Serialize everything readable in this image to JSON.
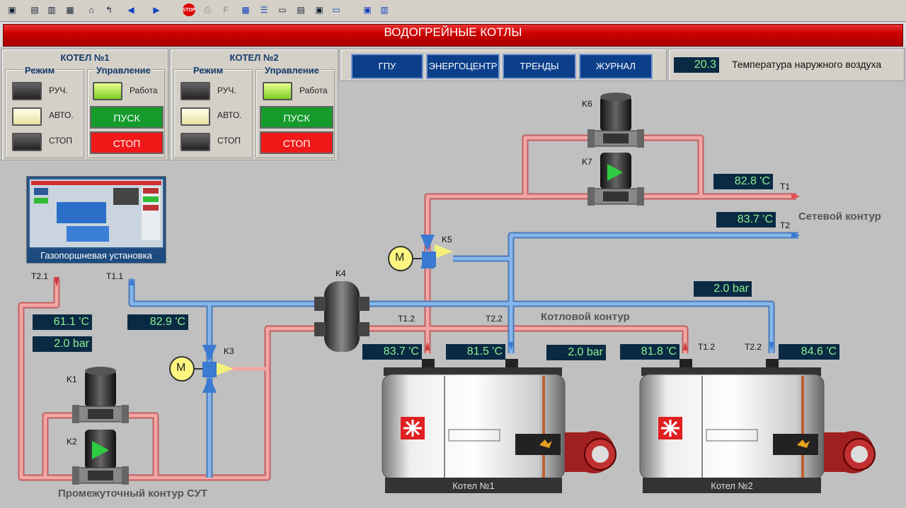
{
  "title": "ВОДОГРЕЙНЫЕ КОТЛЫ",
  "boiler1": {
    "title": "КОТЕЛ №1",
    "mode_label": "Режим",
    "control_label": "Управление",
    "modes": [
      "РУЧ.",
      "АВТО.",
      "СТОП"
    ],
    "work_label": "Работа",
    "start_label": "ПУСК",
    "stop_label": "СТОП"
  },
  "boiler2": {
    "title": "КОТЕЛ №2",
    "mode_label": "Режим",
    "control_label": "Управление",
    "modes": [
      "РУЧ.",
      "АВТО.",
      "СТОП"
    ],
    "work_label": "Работа",
    "start_label": "ПУСК",
    "stop_label": "СТОП"
  },
  "nav": [
    "ГПУ",
    "ЭНЕРГОЦЕНТР",
    "ТРЕНДЫ",
    "ЖУРНАЛ"
  ],
  "outdoor": {
    "value": "20.3",
    "label": "Температура наружного воздуха"
  },
  "gpu_label": "Газопоршневая установка",
  "circuits": {
    "network": "Сетевой контур",
    "boiler": "Котловой контур",
    "intermediate": "Промежуточный контур СУТ"
  },
  "readouts": {
    "t1": "82.8 'C",
    "t2": "83.7 'C",
    "bar_right": "2.0 bar",
    "t21": "61.1 'C",
    "bar_left": "2.0 bar",
    "t11": "82.9 'C",
    "b1_t12": "83.7 'C",
    "b1_t22": "81.5 'C",
    "bar_mid": "2.0 bar",
    "b2_t12": "81.8 'C",
    "b2_t22": "84.6 'C"
  },
  "tags": {
    "T1": "T1",
    "T2": "T2",
    "T21": "T2.1",
    "T11": "T1.1",
    "T12": "T1.2",
    "T22": "T2.2",
    "K1": "K1",
    "K2": "K2",
    "K3": "K3",
    "K4": "K4",
    "K5": "K5",
    "K6": "K6",
    "K7": "K7",
    "M": "M"
  },
  "boilers": [
    "Котел №1",
    "Котел №2"
  ],
  "colors": {
    "hot": "#f0a0a0",
    "cold": "#7ab0e8",
    "title_red": "#d00000",
    "nav_blue": "#0c3f8a",
    "readout_bg": "#0a2a44",
    "readout_text": "#8ef08e"
  },
  "toolbar_icons": [
    "print-icon",
    "window-icon",
    "layers-icon",
    "chart-icon",
    "home-icon",
    "back-icon",
    "left-arrow-icon",
    "right-arrow-icon",
    "stop-icon",
    "doc-icon",
    "f-icon",
    "grid-icon",
    "list-icon",
    "monitor-icon",
    "form-icon",
    "doc2-icon",
    "rect-icon",
    "view-icon",
    "view2-icon"
  ],
  "toolbar_texts": {
    "stop": "STOP",
    "f": "F"
  }
}
